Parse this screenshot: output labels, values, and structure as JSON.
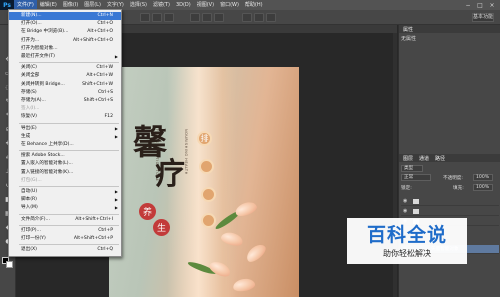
{
  "app": {
    "logo": "Ps"
  },
  "menubar": {
    "items": [
      "文件(F)",
      "编辑(E)",
      "图像(I)",
      "图层(L)",
      "文字(Y)",
      "选择(S)",
      "滤镜(T)",
      "3D(D)",
      "视图(V)",
      "窗口(W)",
      "帮助(H)"
    ]
  },
  "window_controls": {
    "minimize": "−",
    "maximize": "□",
    "close": "×"
  },
  "optionsbar": {
    "workspace": "基本功能"
  },
  "file_menu": {
    "items": [
      {
        "label": "新建(N)...",
        "shortcut": "Ctrl+N",
        "state": "highlighted"
      },
      {
        "label": "打开(O)...",
        "shortcut": "Ctrl+O"
      },
      {
        "label": "在 Bridge 中浏览(B)...",
        "shortcut": "Alt+Ctrl+O"
      },
      {
        "label": "打开为...",
        "shortcut": "Alt+Shift+Ctrl+O"
      },
      {
        "label": "打开为智能对象..."
      },
      {
        "label": "最近打开文件(T)",
        "submenu": true
      },
      {
        "label": "关闭(C)",
        "shortcut": "Ctrl+W"
      },
      {
        "label": "关闭全部",
        "shortcut": "Alt+Ctrl+W"
      },
      {
        "label": "关闭并转到 Bridge...",
        "shortcut": "Shift+Ctrl+W"
      },
      {
        "label": "存储(S)",
        "shortcut": "Ctrl+S"
      },
      {
        "label": "存储为(A)...",
        "shortcut": "Shift+Ctrl+S"
      },
      {
        "label": "签入(I)...",
        "state": "disabled"
      },
      {
        "label": "恢复(V)",
        "shortcut": "F12"
      },
      {
        "label": "导出(E)",
        "submenu": true
      },
      {
        "label": "生成",
        "submenu": true
      },
      {
        "label": "在 Behance 上共享(D)..."
      },
      {
        "label": "搜索 Adobe Stock..."
      },
      {
        "label": "置入嵌入的智能对象(L)..."
      },
      {
        "label": "置入链接的智能对象(K)..."
      },
      {
        "label": "打包(G)...",
        "state": "disabled"
      },
      {
        "label": "自动(U)",
        "submenu": true
      },
      {
        "label": "脚本(R)",
        "submenu": true
      },
      {
        "label": "导入(M)",
        "submenu": true
      },
      {
        "label": "文件简介(F)...",
        "shortcut": "Alt+Shift+Ctrl+I"
      },
      {
        "label": "打印(P)...",
        "shortcut": "Ctrl+P"
      },
      {
        "label": "打印一份(Y)",
        "shortcut": "Alt+Shift+Ctrl+P"
      },
      {
        "label": "退出(X)",
        "shortcut": "Ctrl+Q"
      }
    ]
  },
  "poster": {
    "vertical_left": "FIVE GENERATION TONE",
    "vertical_right": "NOURISHING HEALTH",
    "calligraphy_1": "馨",
    "calligraphy_2": "疗",
    "red_1": "养",
    "red_2": "生",
    "circle_1": "排"
  },
  "panels": {
    "properties_tab": "属性",
    "properties_header": "无属性",
    "layers_tab": "图层",
    "channels_tab": "通道",
    "paths_tab": "路径",
    "kind": "类型",
    "blend": "正常",
    "opacity_label": "不透明度:",
    "opacity": "100%",
    "lock_label": "锁定:",
    "fill_label": "填充:",
    "fill": "100%",
    "selected_layer": "矢量智能对象"
  },
  "watermark": {
    "title": "百科全说",
    "subtitle": "助你轻松解决"
  }
}
